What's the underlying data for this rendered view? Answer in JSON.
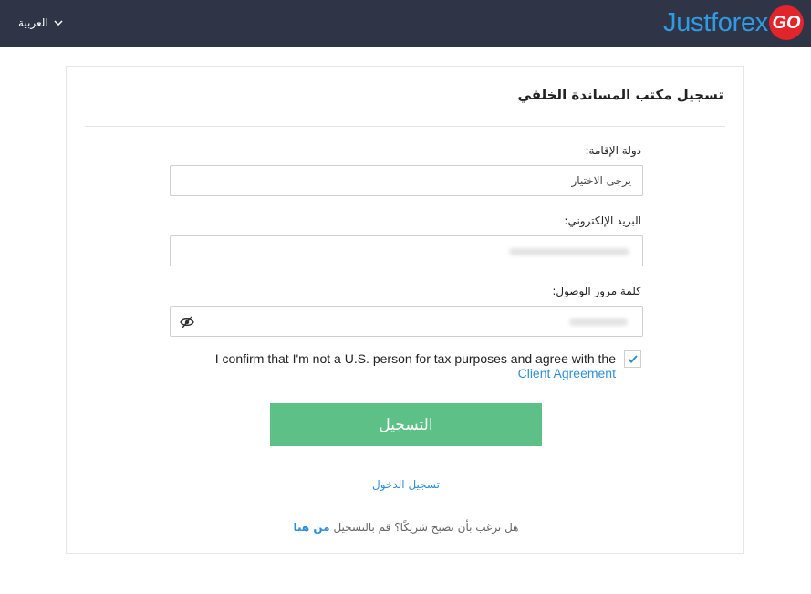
{
  "header": {
    "language": "العربية",
    "logo_text": "Justforex",
    "logo_badge": "GO",
    "logo_text_color": "#2f9be5",
    "logo_badge_color": "#e3242b",
    "bar_color": "#2f3546"
  },
  "form": {
    "title": "تسجيل مكتب المساندة الخلفي",
    "country_label": "دولة الإقامة:",
    "country_value": "يرجى الاختيار",
    "email_label": "البريد الإلكتروني:",
    "password_label": "كلمة مرور الوصول:",
    "confirm_text": "I confirm that I'm not a U.S. person for tax purposes and agree with the",
    "confirm_link": "Client Agreement",
    "confirm_checked": true,
    "submit_label": "التسجيل",
    "submit_color": "#5dc086",
    "login_link": "تسجيل الدخول",
    "partner_text": "هل ترغب بأن تصبح شريكًا؟ قم بالتسجيل",
    "partner_link": "من هنا",
    "link_color": "#2f8fd9"
  }
}
